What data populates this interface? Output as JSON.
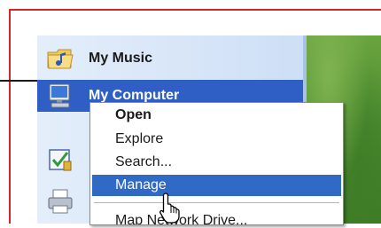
{
  "start_menu": {
    "items": [
      {
        "label": "My Music",
        "icon": "music-folder-icon"
      },
      {
        "label": "My Computer",
        "icon": "computer-icon",
        "state": "selected"
      },
      {
        "label": "",
        "icon": "control-panel-icon"
      },
      {
        "label": "",
        "icon": "printer-icon"
      }
    ]
  },
  "context_menu": {
    "items": [
      {
        "label": "Open",
        "bold": true
      },
      {
        "label": "Explore"
      },
      {
        "label": "Search..."
      },
      {
        "label": "Manage",
        "highlighted": true
      },
      {
        "label": "Map Network Drive..."
      }
    ]
  },
  "colors": {
    "frame_border": "#d0262e",
    "selection": "#316ac5",
    "start_panel": "#d7e5f8",
    "desktop": "#4b8b2f"
  }
}
